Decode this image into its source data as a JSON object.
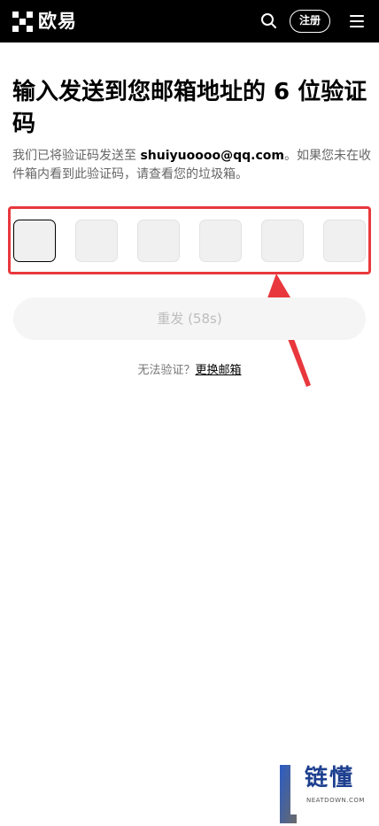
{
  "header": {
    "logo_text": "欧易",
    "search_icon": "search-icon",
    "register_label": "注册",
    "menu_icon": "hamburger-menu-icon"
  },
  "main": {
    "title": "输入发送到您邮箱地址的 6 位验证码",
    "subtitle_prefix": "我们已将验证码发送至 ",
    "email": "shuiyuoooo@qq.com",
    "subtitle_suffix": "。如果您未在收件箱内看到此验证码，请查看您的垃圾箱。",
    "code_cells": [
      "",
      "",
      "",
      "",
      "",
      ""
    ],
    "resend_label": "重发 (58s)",
    "help_text": "无法验证？",
    "change_email_label": "更换邮箱"
  },
  "colors": {
    "highlight": "#e8383d",
    "header_bg": "#000000"
  },
  "watermark": {
    "text": "链懂",
    "sub": "NEATDOWN.COM"
  }
}
